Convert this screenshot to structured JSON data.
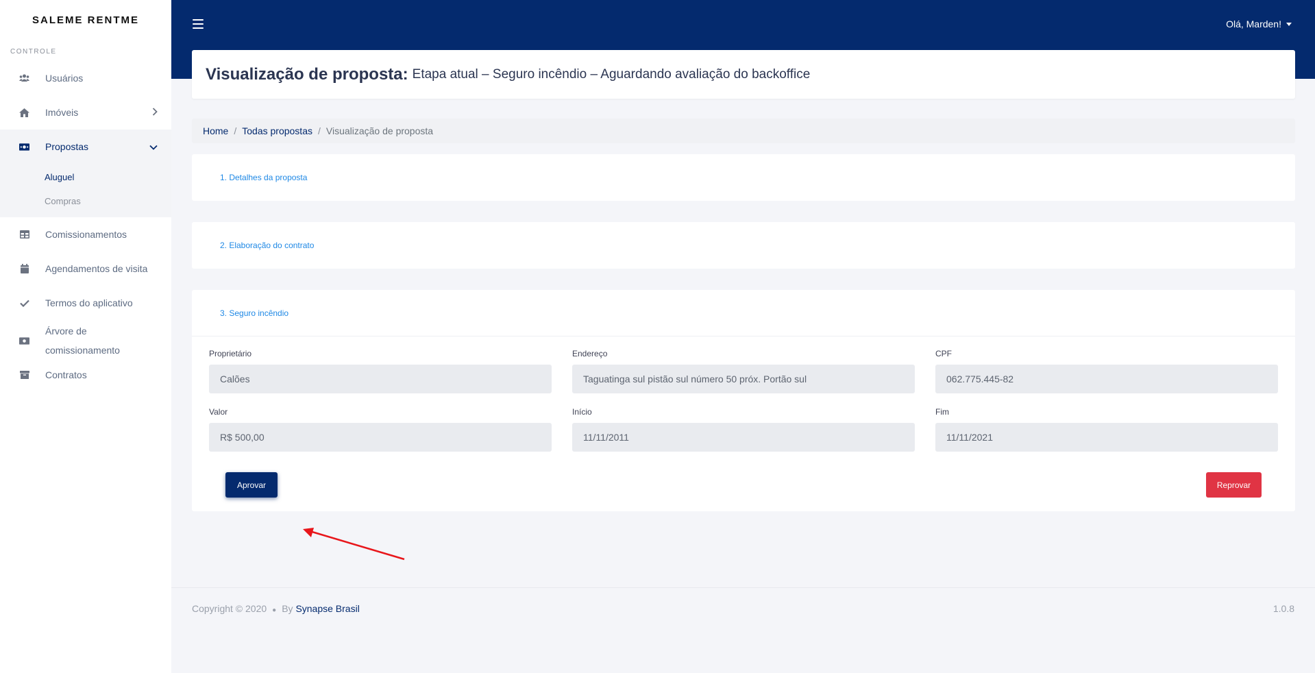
{
  "brand": "SALEME RENTME",
  "sidebar": {
    "section": "CONTROLE",
    "items": [
      {
        "label": "Usuários",
        "icon": "users-icon"
      },
      {
        "label": "Imóveis",
        "icon": "home-icon"
      },
      {
        "label": "Propostas",
        "icon": "money-bill-icon"
      },
      {
        "label": "Comissionamentos",
        "icon": "table-icon"
      },
      {
        "label": "Agendamentos de visita",
        "icon": "calendar-icon"
      },
      {
        "label": "Termos do aplicativo",
        "icon": "check-icon"
      },
      {
        "label": "Árvore de comissionamento",
        "icon": "money-bill-icon"
      },
      {
        "label": "Contratos",
        "icon": "archive-icon"
      }
    ],
    "submenu": [
      "Aluguel",
      "Compras"
    ]
  },
  "topbar": {
    "user": "Olá, Marden!"
  },
  "header": {
    "title": "Visualização de proposta:",
    "subtitle": "Etapa atual – Seguro incêndio – Aguardando avaliação do backoffice"
  },
  "breadcrumb": {
    "home": "Home",
    "all": "Todas propostas",
    "current": "Visualização de proposta"
  },
  "steps": [
    {
      "label": "1. Detalhes da proposta"
    },
    {
      "label": "2. Elaboração do contrato"
    },
    {
      "label": "3. Seguro incêndio"
    }
  ],
  "form": {
    "owner_label": "Proprietário",
    "owner_value": "Calões",
    "address_label": "Endereço",
    "address_value": "Taguatinga sul pistão sul número 50 próx. Portão sul",
    "cpf_label": "CPF",
    "cpf_value": "062.775.445-82",
    "value_label": "Valor",
    "value_value": "R$ 500,00",
    "start_label": "Início",
    "start_value": "11/11/2011",
    "end_label": "Fim",
    "end_value": "11/11/2021"
  },
  "actions": {
    "approve": "Aprovar",
    "reject": "Reprovar"
  },
  "footer": {
    "copyright": "Copyright © 2020",
    "by": "By",
    "company": "Synapse Brasil",
    "version": "1.0.8"
  },
  "colors": {
    "primary": "#042a6e",
    "danger": "#e03444",
    "link": "#1e88e5",
    "annotation": "#e8161b"
  }
}
